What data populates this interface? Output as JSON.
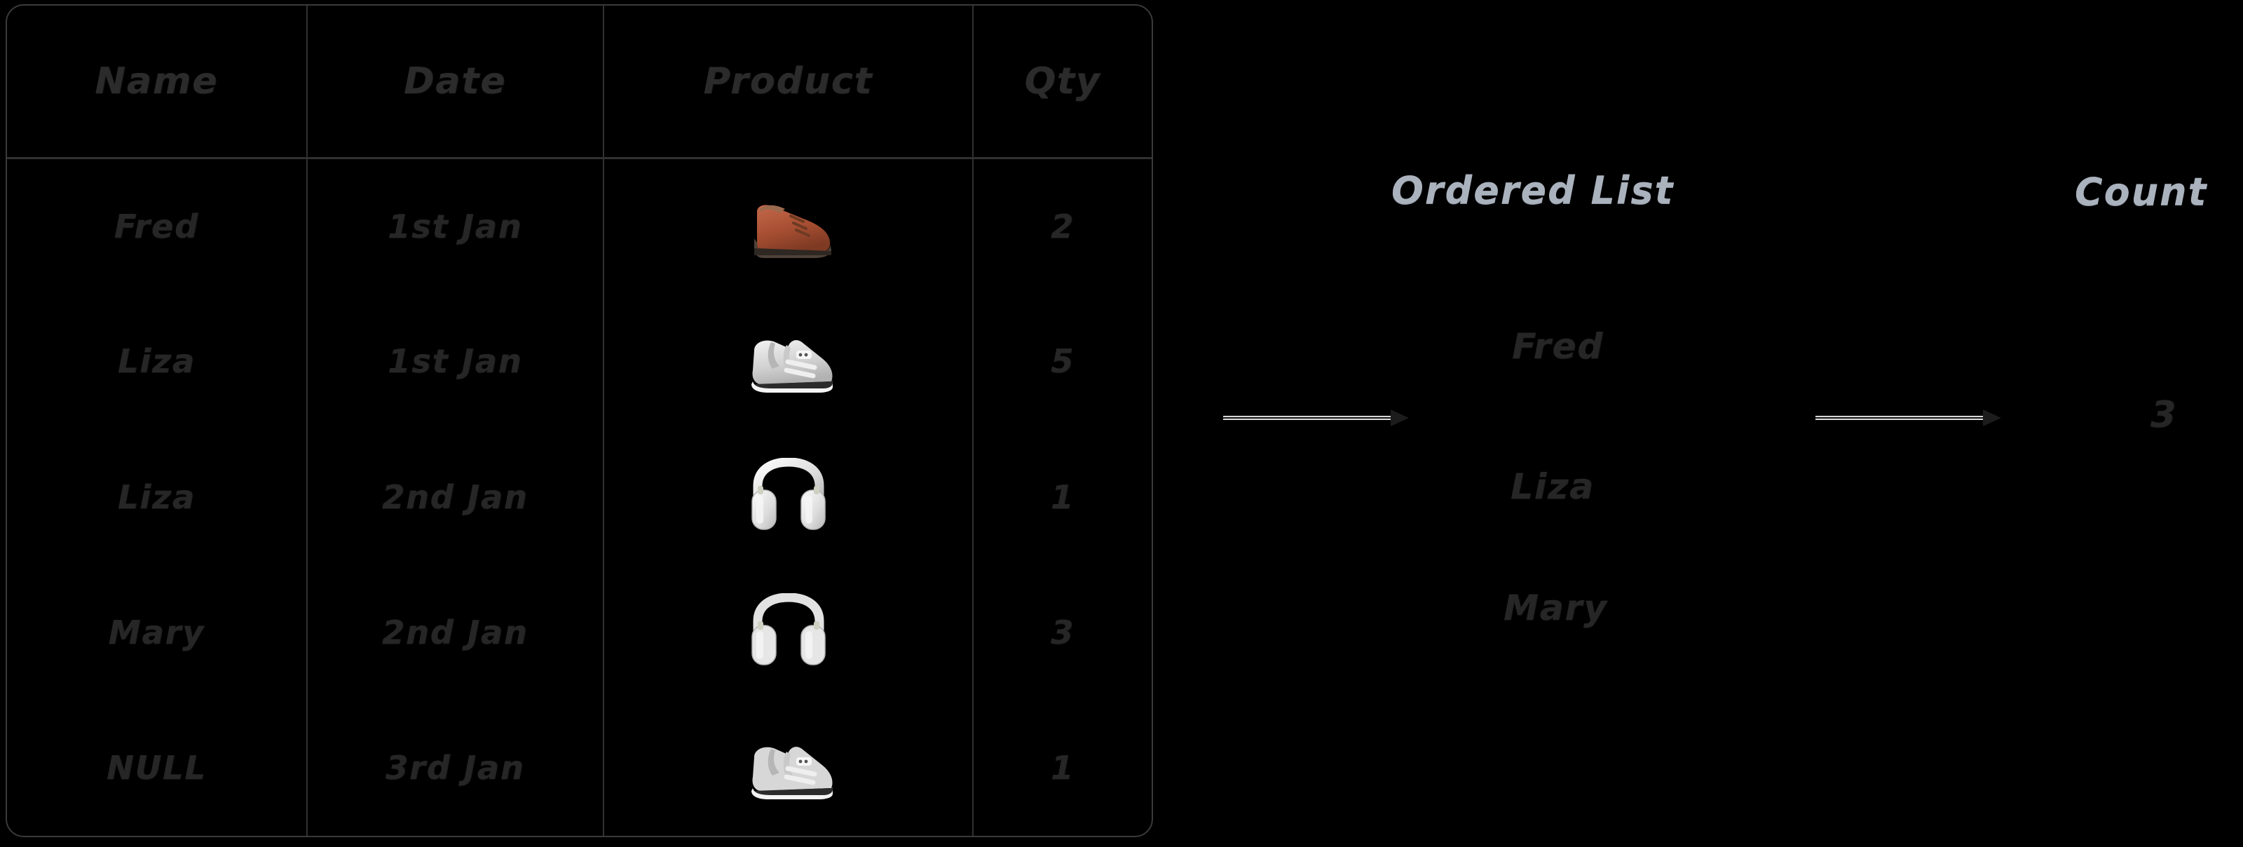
{
  "table": {
    "headers": [
      "Name",
      "Date",
      "Product",
      "Qty"
    ],
    "rows": [
      {
        "name": "Fred",
        "date": "1st Jan",
        "product_icon": "dress-shoe",
        "product_emoji": "👞",
        "qty": "2"
      },
      {
        "name": "Liza",
        "date": "1st Jan",
        "product_icon": "running-shoe",
        "product_emoji": "👟",
        "qty": "5"
      },
      {
        "name": "Liza",
        "date": "2nd Jan",
        "product_icon": "headphones",
        "product_emoji": "🎧",
        "qty": "1"
      },
      {
        "name": "Mary",
        "date": "2nd Jan",
        "product_icon": "headphones",
        "product_emoji": "🎧",
        "qty": "3"
      },
      {
        "name": "NULL",
        "date": "3rd Jan",
        "product_icon": "running-shoe",
        "product_emoji": "👟",
        "qty": "1"
      }
    ]
  },
  "ordered_list": {
    "title": "Ordered List",
    "items": [
      "Fred",
      "Liza",
      "Mary"
    ]
  },
  "count": {
    "title": "Count",
    "value": "3"
  },
  "arrows": [
    {
      "name": "arrow-table-to-list"
    },
    {
      "name": "arrow-list-to-count"
    }
  ],
  "colors": {
    "background": "#000000",
    "table_border": "#3a3a3a",
    "cell_divider": "#313131",
    "hand_text": "#262626",
    "section_title": "#aab2bd",
    "arrow_outline": "#d8d8d8",
    "arrow_core": "#161616"
  }
}
